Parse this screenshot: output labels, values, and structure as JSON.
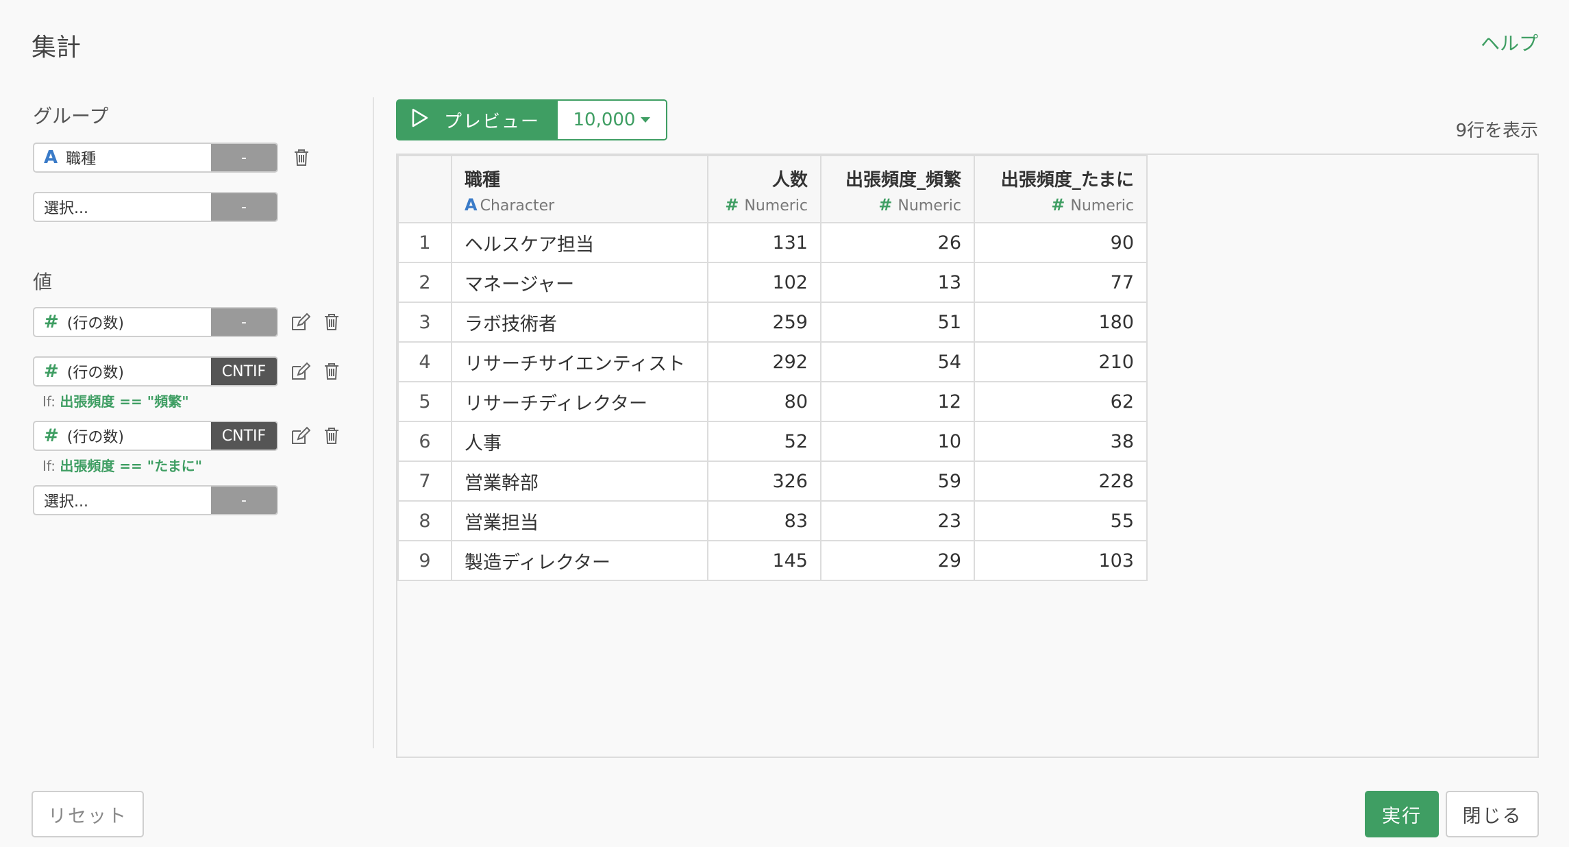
{
  "header": {
    "title": "集計",
    "help": "ヘルプ"
  },
  "left": {
    "group_label": "グループ",
    "value_label": "値",
    "group_fields": [
      {
        "type_icon": "A",
        "name": "職種",
        "fn": "-"
      },
      {
        "name": "選択...",
        "fn": "-"
      }
    ],
    "value_fields": [
      {
        "type_icon": "#",
        "name": "(行の数)",
        "fn": "-"
      },
      {
        "type_icon": "#",
        "name": "(行の数)",
        "fn": "CNTIF",
        "cond_prefix": "If:",
        "cond": "出張頻度 == \"頻繁\""
      },
      {
        "type_icon": "#",
        "name": "(行の数)",
        "fn": "CNTIF",
        "cond_prefix": "If:",
        "cond": "出張頻度 == \"たまに\""
      },
      {
        "name": "選択...",
        "fn": "-"
      }
    ]
  },
  "toolbar": {
    "preview_label": "プレビュー",
    "rows_value": "10,000",
    "row_count": "9行を表示"
  },
  "table": {
    "columns": [
      {
        "name": "職種",
        "type_icon": "A",
        "type": "Character"
      },
      {
        "name": "人数",
        "type_icon": "#",
        "type": "Numeric"
      },
      {
        "name": "出張頻度_頻繁",
        "type_icon": "#",
        "type": "Numeric"
      },
      {
        "name": "出張頻度_たまに",
        "type_icon": "#",
        "type": "Numeric"
      }
    ],
    "rows": [
      [
        "1",
        "ヘルスケア担当",
        "131",
        "26",
        "90"
      ],
      [
        "2",
        "マネージャー",
        "102",
        "13",
        "77"
      ],
      [
        "3",
        "ラボ技術者",
        "259",
        "51",
        "180"
      ],
      [
        "4",
        "リサーチサイエンティスト",
        "292",
        "54",
        "210"
      ],
      [
        "5",
        "リサーチディレクター",
        "80",
        "12",
        "62"
      ],
      [
        "6",
        "人事",
        "52",
        "10",
        "38"
      ],
      [
        "7",
        "営業幹部",
        "326",
        "59",
        "228"
      ],
      [
        "8",
        "営業担当",
        "83",
        "23",
        "55"
      ],
      [
        "9",
        "製造ディレクター",
        "145",
        "29",
        "103"
      ]
    ]
  },
  "footer": {
    "reset": "リセット",
    "run": "実行",
    "close": "閉じる"
  },
  "colors": {
    "accent": "#3f9e63",
    "char_type": "#3a7bc8"
  }
}
